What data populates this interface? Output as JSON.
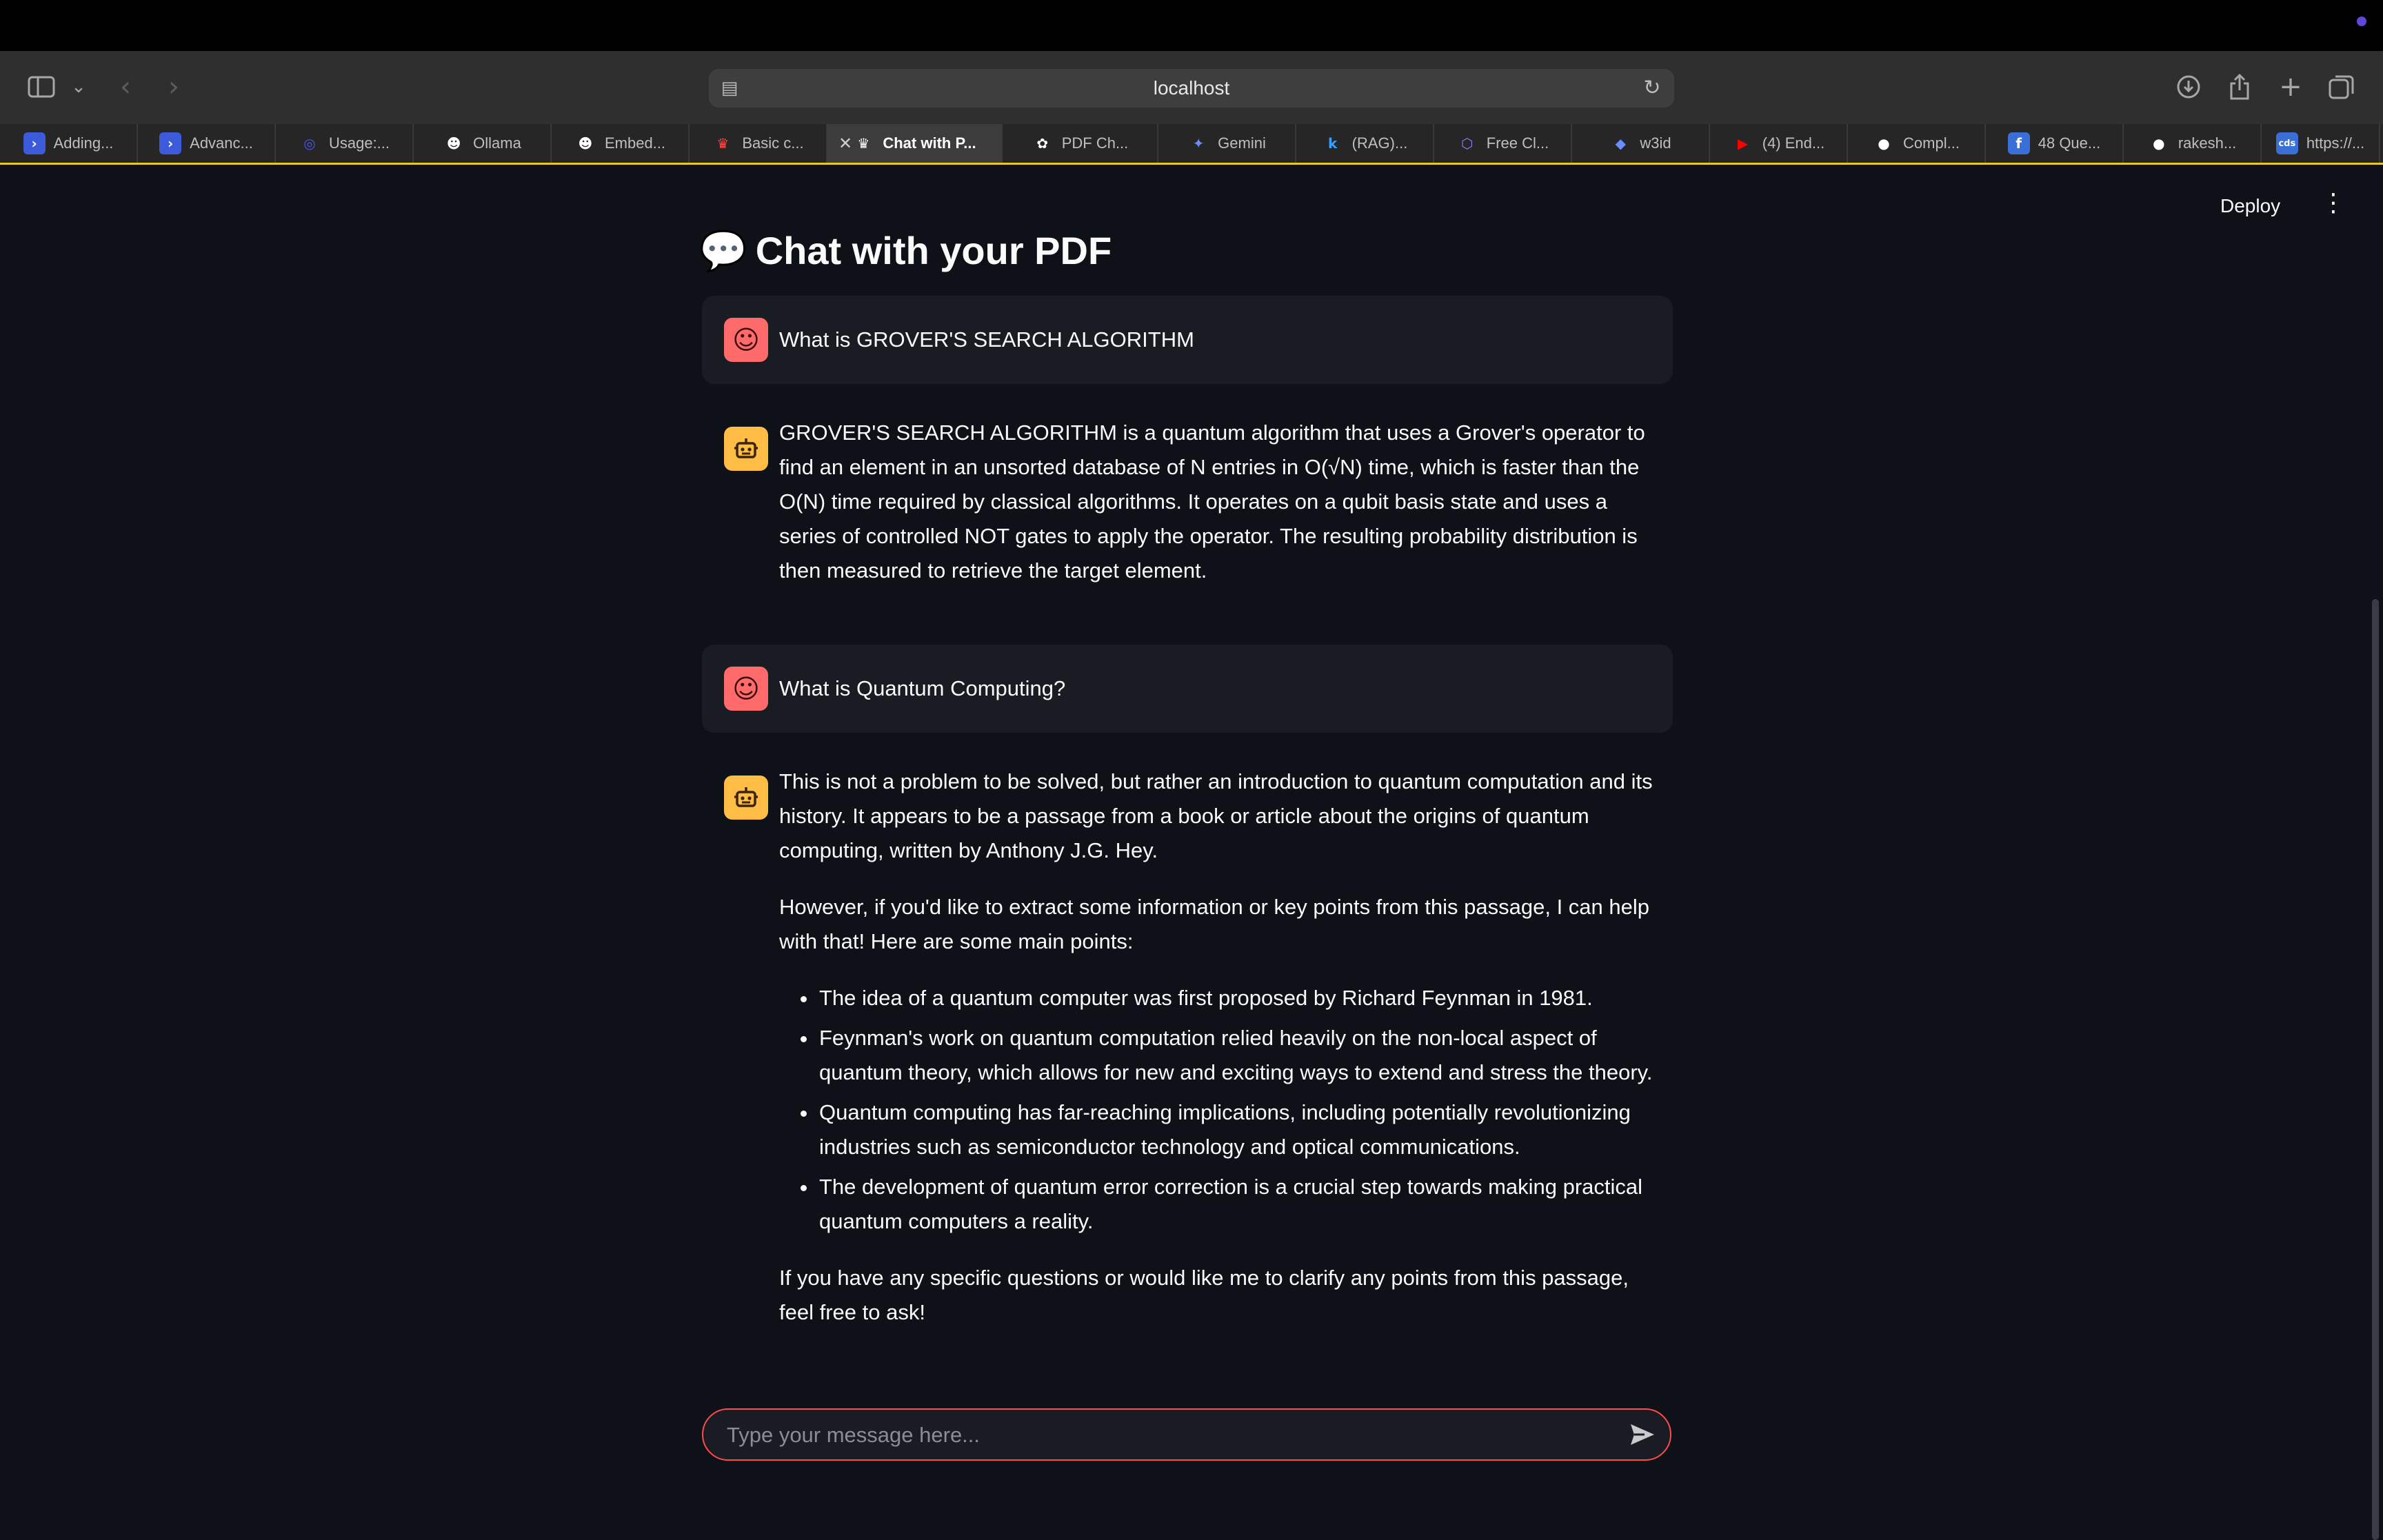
{
  "browser": {
    "url": "localhost",
    "tabs": [
      {
        "label": "Adding...",
        "icon": "powershell-icon",
        "color": "#3b5bdb",
        "glyph": "›",
        "active": false
      },
      {
        "label": "Advanc...",
        "icon": "powershell-icon",
        "color": "#3b5bdb",
        "glyph": "›",
        "active": false
      },
      {
        "label": "Usage:...",
        "icon": "ring-icon",
        "color": "#4c55e8",
        "glyph": "◎",
        "active": false
      },
      {
        "label": "Ollama",
        "icon": "ollama-icon",
        "color": "#ffffff",
        "glyph": "☻",
        "active": false
      },
      {
        "label": "Embed...",
        "icon": "ollama-icon",
        "color": "#ffffff",
        "glyph": "☻",
        "active": false
      },
      {
        "label": "Basic c...",
        "icon": "streamlit-crown-icon",
        "color": "#ff4b4b",
        "glyph": "♛",
        "active": false
      },
      {
        "label": "Chat with P...",
        "icon": "streamlit-crown-icon",
        "color": "#ffffff",
        "glyph": "♛",
        "active": true
      },
      {
        "label": "PDF Ch...",
        "icon": "openai-icon",
        "color": "#ffffff",
        "glyph": "✿",
        "active": false
      },
      {
        "label": "Gemini",
        "icon": "gemini-sparkle-icon",
        "color": "#6f8cff",
        "glyph": "✦",
        "active": false
      },
      {
        "label": "(RAG)...",
        "icon": "k-logo-icon",
        "color": "#3aa0ff",
        "glyph": "k",
        "active": false
      },
      {
        "label": "Free Cl...",
        "icon": "cube-icon",
        "color": "#8e7bff",
        "glyph": "⬡",
        "active": false
      },
      {
        "label": "w3id",
        "icon": "shield-icon",
        "color": "#6c8cff",
        "glyph": "◆",
        "active": false
      },
      {
        "label": "(4) End...",
        "icon": "youtube-icon",
        "color": "#ff0000",
        "glyph": "▶",
        "active": false
      },
      {
        "label": "Compl...",
        "icon": "github-icon",
        "color": "#ffffff",
        "glyph": "●",
        "active": false
      },
      {
        "label": "48 Que...",
        "icon": "document-icon",
        "color": "#3b6fd8",
        "glyph": "f",
        "active": false
      },
      {
        "label": "rakesh...",
        "icon": "github-icon",
        "color": "#ffffff",
        "glyph": "●",
        "active": false
      },
      {
        "label": "https://...",
        "icon": "cds-icon",
        "color": "#3b6fd8",
        "glyph": "cds",
        "active": false
      }
    ]
  },
  "app": {
    "header": {
      "deploy_label": "Deploy"
    },
    "title": "Chat with your PDF",
    "title_icon": "💬",
    "messages": [
      {
        "role": "user",
        "text": "What is GROVER'S SEARCH ALGORITHM"
      },
      {
        "role": "assistant",
        "paragraphs": [
          "GROVER'S SEARCH ALGORITHM is a quantum algorithm that uses a Grover's operator to find an element in an unsorted database of N entries in O(√N) time, which is faster than the O(N) time required by classical algorithms. It operates on a qubit basis state and uses a series of controlled NOT gates to apply the operator. The resulting probability distribution is then measured to retrieve the target element."
        ]
      },
      {
        "role": "user",
        "text": "What is Quantum Computing?"
      },
      {
        "role": "assistant",
        "intro": [
          "This is not a problem to be solved, but rather an introduction to quantum computation and its history. It appears to be a passage from a book or article about the origins of quantum computing, written by Anthony J.G. Hey.",
          "However, if you'd like to extract some information or key points from this passage, I can help with that! Here are some main points:"
        ],
        "bullets": [
          "The idea of a quantum computer was first proposed by Richard Feynman in 1981.",
          "Feynman's work on quantum computation relied heavily on the non-local aspect of quantum theory, which allows for new and exciting ways to extend and stress the theory.",
          "Quantum computing has far-reaching implications, including potentially revolutionizing industries such as semiconductor technology and optical communications.",
          "The development of quantum error correction is a crucial step towards making practical quantum computers a reality."
        ],
        "outro": "If you have any specific questions or would like me to clarify any points from this passage, feel free to ask!"
      }
    ],
    "chat_input": {
      "placeholder": "Type your message here...",
      "value": ""
    }
  },
  "colors": {
    "background": "#0e1117",
    "user_bubble": "#1a1c24",
    "user_avatar": "#ff6b6b",
    "assistant_avatar": "#ffbd45",
    "input_border": "#ff4b4b",
    "active_tab_underline": "#e4c72a"
  }
}
